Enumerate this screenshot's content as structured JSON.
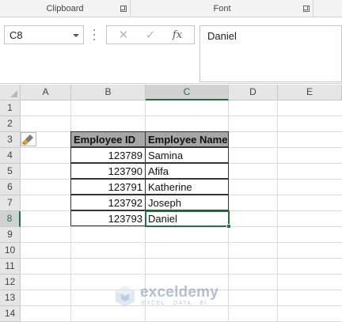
{
  "ribbon": {
    "groups": [
      {
        "label": "Clipboard"
      },
      {
        "label": "Font"
      }
    ]
  },
  "formula_bar": {
    "name_box": "C8",
    "cancel_glyph": "✕",
    "enter_glyph": "✓",
    "fx_label": "fx",
    "content": "Daniel"
  },
  "grid": {
    "columns": [
      "A",
      "B",
      "C",
      "D",
      "E"
    ],
    "rows": [
      "1",
      "2",
      "3",
      "4",
      "5",
      "6",
      "7",
      "8",
      "9",
      "10",
      "11",
      "12",
      "13",
      "14"
    ],
    "active_cell": "C8",
    "active_column": "C",
    "active_row": "8"
  },
  "table": {
    "headers": [
      "Employee ID",
      "Employee Name"
    ],
    "rows": [
      {
        "id": "123789",
        "name": "Samina"
      },
      {
        "id": "123790",
        "name": "Afifa"
      },
      {
        "id": "123791",
        "name": "Katherine"
      },
      {
        "id": "123792",
        "name": "Joseph"
      },
      {
        "id": "123793",
        "name": "Daniel"
      }
    ]
  },
  "paste_options_icon": "paste-options-icon",
  "watermark": {
    "name": "exceldemy",
    "tagline": "EXCEL · DATA · BI"
  },
  "colors": {
    "accent": "#217346",
    "header_fill": "#a6a6a6",
    "watermark": "#7a8fb0"
  }
}
